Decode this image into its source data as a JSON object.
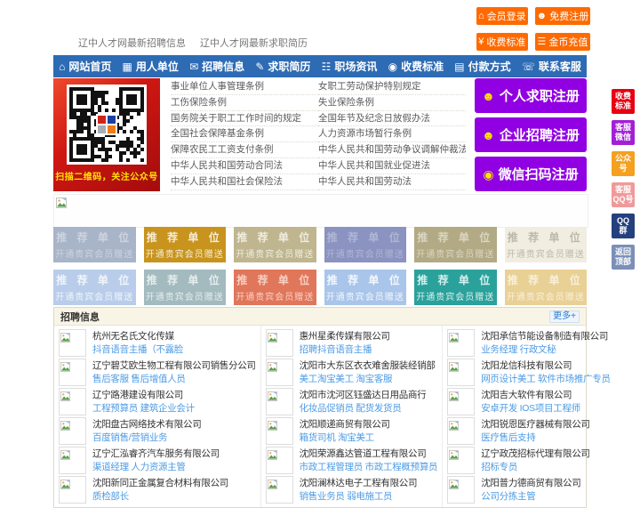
{
  "topbar": {
    "buttons": [
      {
        "label": "会员登录",
        "icon": "home-icon"
      },
      {
        "label": "免费注册",
        "icon": "user-icon"
      },
      {
        "label": "收费标准",
        "icon": "yen-icon"
      },
      {
        "label": "金币充值",
        "icon": "coins-icon"
      }
    ],
    "button_color": "#ff6a00"
  },
  "header_links": [
    {
      "label": "辽中人才网最新招聘信息"
    },
    {
      "label": "辽中人才网最新求职简历"
    }
  ],
  "nav": {
    "bg_color": "#2d6bb4",
    "items": [
      {
        "label": "网站首页",
        "icon": "home-icon"
      },
      {
        "label": "用人单位",
        "icon": "building-icon"
      },
      {
        "label": "招聘信息",
        "icon": "megaphone-icon"
      },
      {
        "label": "求职简历",
        "icon": "resume-icon"
      },
      {
        "label": "职场资讯",
        "icon": "news-icon"
      },
      {
        "label": "收费标准",
        "icon": "fee-icon"
      },
      {
        "label": "付款方式",
        "icon": "payment-icon"
      },
      {
        "label": "联系客服",
        "icon": "service-icon"
      }
    ]
  },
  "qr": {
    "caption": "扫描二维码，关注公众号",
    "banner_color": "#c41310",
    "logo_colors": [
      "#cf2318",
      "#1d3fa0",
      "#a9adb2",
      "#ef7c1a"
    ]
  },
  "law_links": [
    {
      "label": "事业单位人事管理条例"
    },
    {
      "label": "女职工劳动保护特别规定"
    },
    {
      "label": "工伤保险条例"
    },
    {
      "label": "失业保险条例"
    },
    {
      "label": "国务院关于职工工作时间的规定"
    },
    {
      "label": "全国年节及纪念日放假办法"
    },
    {
      "label": "全国社会保障基金条例"
    },
    {
      "label": "人力资源市场暂行条例"
    },
    {
      "label": "保障农民工工资支付条例"
    },
    {
      "label": "中华人民共和国劳动争议调解仲裁法"
    },
    {
      "label": "中华人民共和国劳动合同法"
    },
    {
      "label": "中华人民共和国就业促进法"
    },
    {
      "label": "中华人民共和国社会保险法"
    },
    {
      "label": "中华人民共和国劳动法"
    }
  ],
  "register": {
    "bg_color": "#9100e2",
    "icon_color": "#ffe400",
    "buttons": [
      {
        "label": "个人求职注册",
        "icon": "user-plus-icon"
      },
      {
        "label": "企业招聘注册",
        "icon": "enterprise-user-icon"
      },
      {
        "label": "微信扫码注册",
        "icon": "wechat-icon"
      }
    ]
  },
  "promo": {
    "title": "推 荐 单 位",
    "subtitle": "开通贵宾会员赠送",
    "cells": [
      {
        "bg": "#a8b4c8",
        "fg": "#cdd4e0"
      },
      {
        "bg": "#c8941d",
        "fg": "#f5ecd8"
      },
      {
        "bg": "#bfb68f",
        "fg": "#efece0"
      },
      {
        "bg": "#8b93c0",
        "fg": "#b0b6d5"
      },
      {
        "bg": "#b2aa84",
        "fg": "#dad6c2"
      },
      {
        "bg": "#f1ede1",
        "fg": "#bdb8aa"
      },
      {
        "bg": "#b9cdea",
        "fg": "#f0f5fb"
      },
      {
        "bg": "#a3babf",
        "fg": "#e6edee"
      },
      {
        "bg": "#e0765a",
        "fg": "#f6d0c5"
      },
      {
        "bg": "#a9c5e9",
        "fg": "#f2f7fc"
      },
      {
        "bg": "#2ba19b",
        "fg": "#d6f0ee"
      },
      {
        "bg": "#e9d095",
        "fg": "#f8f0da"
      }
    ]
  },
  "jobs": {
    "title": "招聘信息",
    "more": "更多+",
    "columns": [
      [
        {
          "company": "杭州无名氏文化传媒",
          "positions": "抖音语音主播（不露脸"
        },
        {
          "company": "辽宁碧艾欧生物工程有限公司销售分公司",
          "positions": "售后客服 售后增值人员"
        },
        {
          "company": "辽宁路港建设有限公司",
          "positions": "工程预算员 建筑企业会计"
        },
        {
          "company": "沈阳盘古网络技术有限公司",
          "positions": "百度销售/营销业务"
        },
        {
          "company": "辽宁汇泓睿齐汽车服务有限公司",
          "positions": "渠道经理 人力资源主管"
        },
        {
          "company": "沈阳新同正金属复合材料有限公司",
          "positions": "质检部长"
        }
      ],
      [
        {
          "company": "惠州星柔传媒有限公司",
          "positions": "招聘抖音语音主播"
        },
        {
          "company": "沈阳市大东区衣衣难舍服装经销部",
          "positions": "美工淘宝美工 淘宝客服"
        },
        {
          "company": "沈阳市沈河区钰盛达日用品商行",
          "positions": "化妆品促销员 配货发货员"
        },
        {
          "company": "沈阳顺递商贸有限公司",
          "positions": "箱货司机 淘宝美工"
        },
        {
          "company": "沈阳荣源鑫达管道工程有限公司",
          "positions": "市政工程管理员 市政工程概预算员"
        },
        {
          "company": "沈阳澜林达电子工程有限公司",
          "positions": "销售业务员 弱电施工员"
        }
      ],
      [
        {
          "company": "沈阳承信节能设备制造有限公司",
          "positions": "业务经理 行政文秘"
        },
        {
          "company": "沈阳龙信科技有限公司",
          "positions": "网页设计美工 软件市场推广专员"
        },
        {
          "company": "沈阳吉大软件有限公司",
          "positions": "安卓开发 IOS项目工程师"
        },
        {
          "company": "沈阳锐恩医疗器械有限公司",
          "positions": "医疗售后支持"
        },
        {
          "company": "辽宁政茂招标代理有限公司",
          "positions": "招标专员"
        },
        {
          "company": "沈阳普力德商贸有限公司",
          "positions": "公司分拣主管"
        }
      ]
    ]
  },
  "side_float": [
    {
      "name": "fee-standard",
      "lines": [
        "收费",
        "标准"
      ],
      "bg": "#e60012"
    },
    {
      "name": "service-wechat",
      "lines": [
        "客服",
        "微信"
      ],
      "bg": "#a21fd6"
    },
    {
      "name": "official-account",
      "lines": [
        "公众",
        "号"
      ],
      "bg": "#f5a01e"
    },
    {
      "name": "service-qq",
      "lines": [
        "客服",
        "QQ号"
      ],
      "bg": "#ef9a9a"
    },
    {
      "name": "qq-group",
      "lines": [
        "QQ",
        "群"
      ],
      "bg": "#24407e"
    },
    {
      "name": "back-to-top",
      "lines": [
        "返回",
        "顶部"
      ],
      "bg": "#7b8fb8"
    }
  ]
}
